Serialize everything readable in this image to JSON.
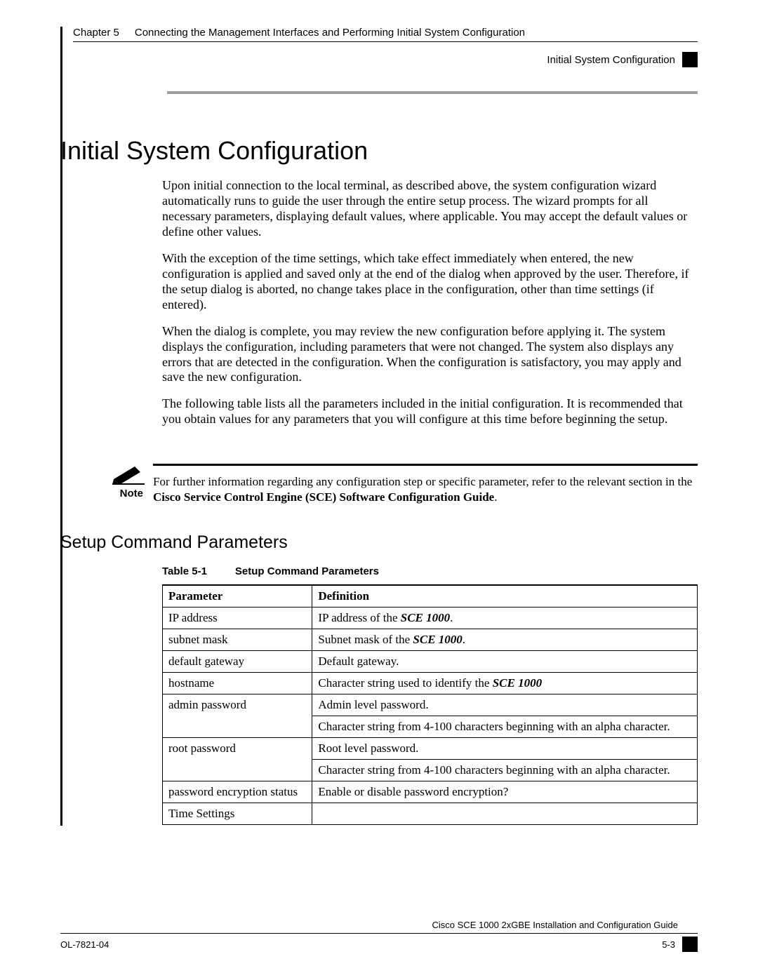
{
  "header": {
    "chapter_label": "Chapter 5",
    "chapter_title": "Connecting the Management Interfaces and Performing Initial System Configuration",
    "section_tag": "Initial System Configuration"
  },
  "h1": "Initial System Configuration",
  "paragraphs": {
    "p1": "Upon initial connection to the local terminal, as described above, the system configuration wizard automatically runs to guide the user through the entire setup process. The wizard prompts for all necessary parameters, displaying default values, where applicable. You may accept the default values or define other values.",
    "p2": "With the exception of the time settings, which take effect immediately when entered, the new configuration is applied and saved only at the end of the dialog when approved by the user. Therefore, if the setup dialog is aborted, no change takes place in the configuration, other than time settings (if entered).",
    "p3": "When the dialog is complete, you may review the new configuration before applying it. The system displays the configuration, including parameters that were not changed. The system also displays any errors that are detected in the configuration. When the configuration is satisfactory, you may apply and save the new configuration.",
    "p4": "The following table lists all the parameters included in the initial configuration. It is recommended that you obtain values for any parameters that you will configure at this time before beginning the setup."
  },
  "note": {
    "label": "Note",
    "text_pre": "For further information regarding any configuration step or specific parameter, refer to the relevant section in the ",
    "text_bold": "Cisco Service Control Engine (SCE) Software Configuration Guide",
    "text_post": "."
  },
  "h2": "Setup Command Parameters",
  "table": {
    "caption_num": "Table 5-1",
    "caption_title": "Setup Command Parameters",
    "head_param": "Parameter",
    "head_def": "Definition",
    "rows": [
      {
        "param": "IP address",
        "def_pre": "IP address of the ",
        "def_em": "SCE 1000",
        "def_post": "."
      },
      {
        "param": "subnet mask",
        "def_pre": "Subnet mask of the ",
        "def_em": "SCE 1000",
        "def_post": "."
      },
      {
        "param": "default gateway",
        "def_pre": "Default gateway.",
        "def_em": "",
        "def_post": ""
      },
      {
        "param": "hostname",
        "def_pre": "Character string used to identify the ",
        "def_em": "SCE 1000",
        "def_post": ""
      },
      {
        "param": "admin password",
        "def_pre": "Admin level password.",
        "def_em": "",
        "def_post": "",
        "def2": "Character string from 4-100 characters beginning with an alpha character."
      },
      {
        "param": "root password",
        "def_pre": "Root level password.",
        "def_em": "",
        "def_post": "",
        "def2": "Character string from 4-100 characters beginning with an alpha character."
      },
      {
        "param": "password encryption status",
        "def_pre": "Enable or disable password encryption?",
        "def_em": "",
        "def_post": ""
      },
      {
        "param": "Time Settings",
        "def_pre": "",
        "def_em": "",
        "def_post": ""
      }
    ]
  },
  "footer": {
    "guide": "Cisco SCE 1000 2xGBE Installation and Configuration Guide",
    "docnum": "OL-7821-04",
    "pagenum": "5-3"
  }
}
